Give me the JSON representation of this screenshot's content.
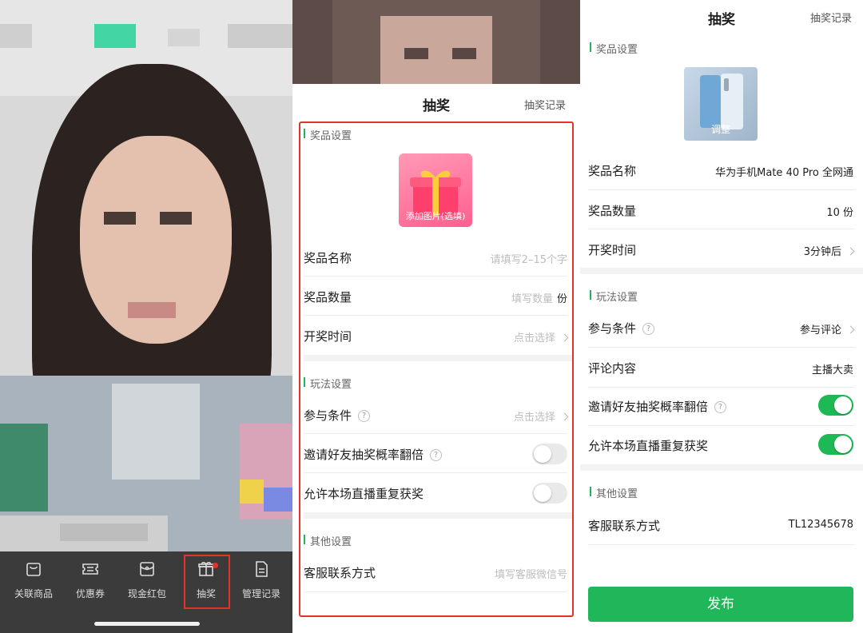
{
  "panel1": {
    "nav": [
      {
        "label": "关联商品",
        "icon": "bag-icon"
      },
      {
        "label": "优惠券",
        "icon": "coupon-icon"
      },
      {
        "label": "现金红包",
        "icon": "red-packet-icon"
      },
      {
        "label": "抽奖",
        "icon": "gift-icon"
      },
      {
        "label": "管理记录",
        "icon": "document-icon"
      }
    ]
  },
  "panel2": {
    "title": "抽奖",
    "record_link": "抽奖记录",
    "prize_section": "奖品设置",
    "add_image": "添加图片(选填)",
    "prize_name_label": "奖品名称",
    "prize_name_placeholder": "请填写2–15个字",
    "prize_qty_label": "奖品数量",
    "prize_qty_placeholder": "填写数量",
    "prize_qty_unit": "份",
    "draw_time_label": "开奖时间",
    "draw_time_value": "点击选择",
    "play_section": "玩法设置",
    "condition_label": "参与条件",
    "condition_value": "点击选择",
    "invite_label": "邀请好友抽奖概率翻倍",
    "repeat_label": "允许本场直播重复获奖",
    "invite_on": false,
    "repeat_on": false,
    "other_section": "其他设置",
    "contact_label": "客服联系方式",
    "contact_placeholder": "填写客服微信号"
  },
  "panel3": {
    "title": "抽奖",
    "record_link": "抽奖记录",
    "prize_section": "奖品设置",
    "adjust": "调整",
    "prize_name_label": "奖品名称",
    "prize_name_value": "华为手机Mate 40 Pro 全网通",
    "prize_qty_label": "奖品数量",
    "prize_qty_value": "10 份",
    "draw_time_label": "开奖时间",
    "draw_time_value": "3分钟后",
    "play_section": "玩法设置",
    "condition_label": "参与条件",
    "condition_value": "参与评论",
    "comment_label": "评论内容",
    "comment_value": "主播大卖",
    "invite_label": "邀请好友抽奖概率翻倍",
    "repeat_label": "允许本场直播重复获奖",
    "invite_on": true,
    "repeat_on": true,
    "other_section": "其他设置",
    "contact_label": "客服联系方式",
    "contact_value": "TL12345678",
    "publish": "发布"
  },
  "colors": {
    "accent_green": "#1fb75a",
    "highlight_red": "#e0332b"
  }
}
